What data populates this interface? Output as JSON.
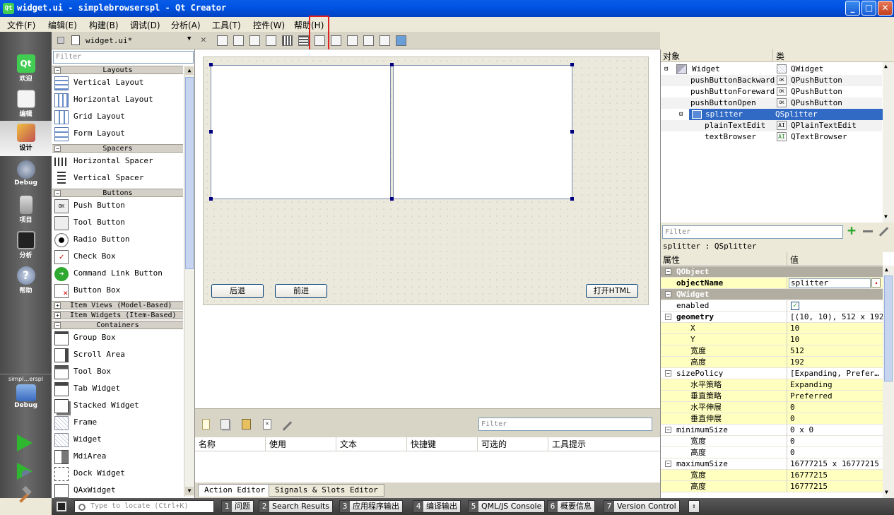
{
  "window": {
    "title": "widget.ui - simplebrowserspl - Qt Creator",
    "app_icon": "qt",
    "controls": [
      "_",
      "□",
      "✕"
    ]
  },
  "menubar": {
    "items": [
      "文件(F)",
      "编辑(E)",
      "构建(B)",
      "调试(D)",
      "分析(A)",
      "工具(T)",
      "控件(W)",
      "帮助(H)"
    ]
  },
  "modes": [
    {
      "label": "欢迎",
      "icon": "qt-welcome-icon"
    },
    {
      "label": "编辑",
      "icon": "edit-document-icon"
    },
    {
      "label": "设计",
      "icon": "design-brush-icon",
      "active": true
    },
    {
      "label": "Debug",
      "icon": "debug-bug-icon"
    },
    {
      "label": "项目",
      "icon": "project-icon"
    },
    {
      "label": "分析",
      "icon": "analyze-oscilloscope-icon"
    },
    {
      "label": "帮助",
      "icon": "help-icon"
    }
  ],
  "kit": {
    "project": "simpl…erspl",
    "config": "Debug"
  },
  "editor_tab": {
    "filename": "widget.ui*"
  },
  "widget_box": {
    "filter_placeholder": "Filter",
    "categories": {
      "layouts": "Layouts",
      "spacers": "Spacers",
      "buttons": "Buttons",
      "item_views": "Item Views (Model-Based)",
      "item_widgets": "Item Widgets (Item-Based)",
      "containers": "Containers"
    },
    "layouts": [
      "Vertical Layout",
      "Horizontal Layout",
      "Grid Layout",
      "Form Layout"
    ],
    "spacers": [
      "Horizontal Spacer",
      "Vertical Spacer"
    ],
    "buttons": [
      "Push Button",
      "Tool Button",
      "Radio Button",
      "Check Box",
      "Command Link Button",
      "Button Box"
    ],
    "containers": [
      "Group Box",
      "Scroll Area",
      "Tool Box",
      "Tab Widget",
      "Stacked Widget",
      "Frame",
      "Widget",
      "MdiArea",
      "Dock Widget",
      "QAxWidget"
    ]
  },
  "form": {
    "buttons": {
      "backward": "后退",
      "forward": "前进",
      "open": "打开HTML"
    }
  },
  "action_editor": {
    "filter_placeholder": "Filter",
    "columns": [
      "名称",
      "使用",
      "文本",
      "快捷键",
      "可选的",
      "工具提示"
    ],
    "tabs": [
      "Action Editor",
      "Signals & Slots Editor"
    ]
  },
  "object_inspector": {
    "col_object": "对象",
    "col_class": "类",
    "rows": [
      {
        "name": "Widget",
        "class": "QWidget",
        "icon": "widget-icon"
      },
      {
        "name": "pushButtonBackward",
        "class": "QPushButton",
        "icon": "pushbutton-icon"
      },
      {
        "name": "pushButtonForeward",
        "class": "QPushButton",
        "icon": "pushbutton-icon"
      },
      {
        "name": "pushButtonOpen",
        "class": "QPushButton",
        "icon": "pushbutton-icon"
      },
      {
        "name": "splitter",
        "class": "QSplitter",
        "icon": "splitter-icon",
        "selected": true
      },
      {
        "name": "plainTextEdit",
        "class": "QPlainTextEdit",
        "icon": "plaintextedit-icon"
      },
      {
        "name": "textBrowser",
        "class": "QTextBrowser",
        "icon": "textbrowser-icon"
      }
    ]
  },
  "property_editor": {
    "filter_placeholder": "Filter",
    "class_line": "splitter : QSplitter",
    "col_property": "属性",
    "col_value": "值",
    "rows": [
      {
        "name": "QObject",
        "value": "",
        "kind": "group"
      },
      {
        "name": "objectName",
        "value": "splitter",
        "kind": "bold-yellow"
      },
      {
        "name": "QWidget",
        "value": "",
        "kind": "group"
      },
      {
        "name": "enabled",
        "value": "✓",
        "kind": "plain"
      },
      {
        "name": "geometry",
        "value": "[(10, 10), 512 x 192]",
        "kind": "bold-expander"
      },
      {
        "name": "X",
        "value": "10",
        "kind": "child-yellow"
      },
      {
        "name": "Y",
        "value": "10",
        "kind": "child-yellow"
      },
      {
        "name": "宽度",
        "value": "512",
        "kind": "child-yellow"
      },
      {
        "name": "高度",
        "value": "192",
        "kind": "child-yellow"
      },
      {
        "name": "sizePolicy",
        "value": "[Expanding, Prefer…",
        "kind": "expander"
      },
      {
        "name": "水平策略",
        "value": "Expanding",
        "kind": "child-yellow"
      },
      {
        "name": "垂直策略",
        "value": "Preferred",
        "kind": "child-yellow"
      },
      {
        "name": "水平伸展",
        "value": "0",
        "kind": "child-yellow"
      },
      {
        "name": "垂直伸展",
        "value": "0",
        "kind": "child-yellow"
      },
      {
        "name": "minimumSize",
        "value": "0 x 0",
        "kind": "expander"
      },
      {
        "name": "宽度",
        "value": "0",
        "kind": "child"
      },
      {
        "name": "高度",
        "value": "0",
        "kind": "child"
      },
      {
        "name": "maximumSize",
        "value": "16777215 x 16777215",
        "kind": "expander"
      },
      {
        "name": "宽度",
        "value": "16777215",
        "kind": "child-yellow"
      },
      {
        "name": "高度",
        "value": "16777215",
        "kind": "child-yellow"
      }
    ]
  },
  "statusbar": {
    "locate_placeholder": "Type to locate (Ctrl+K)",
    "panes": [
      {
        "num": "1",
        "label": "问题"
      },
      {
        "num": "2",
        "label": "Search Results"
      },
      {
        "num": "3",
        "label": "应用程序输出"
      },
      {
        "num": "4",
        "label": "编译输出"
      },
      {
        "num": "5",
        "label": "QML/JS Console"
      },
      {
        "num": "6",
        "label": "概要信息"
      },
      {
        "num": "7",
        "label": "Version Control"
      }
    ]
  },
  "colors": {
    "accent": "#316ac5",
    "selection_highlight": "#e02020",
    "property_group": "#b1ada1",
    "property_changed": "#ffffbf"
  }
}
